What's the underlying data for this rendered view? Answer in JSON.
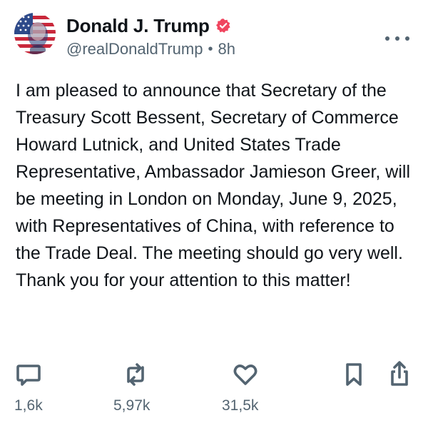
{
  "author": {
    "display_name": "Donald J. Trump",
    "handle": "@realDonaldTrump",
    "separator": "•",
    "time": "8h",
    "verified_badge_color": "#f0455f"
  },
  "icons": {
    "avatar": "flag-portrait-avatar",
    "verified": "verified-badge-icon",
    "more": "more-options-icon"
  },
  "post": {
    "text": "I am pleased to announce that Secretary of the Treasury Scott Bessent, Secretary of Commerce Howard Lutnick, and United States Trade Representative, Ambassador Jamieson Greer, will be meeting in London on Monday, June 9, 2025, with Representatives of China, with reference to the Trade Deal. The meeting should go very well. Thank you for your attention to this matter!"
  },
  "actions": {
    "replies": {
      "icon": "reply-icon",
      "count": "1,6k"
    },
    "retruths": {
      "icon": "retruth-icon",
      "count": "5,97k"
    },
    "likes": {
      "icon": "heart-icon",
      "count": "31,5k"
    },
    "bookmark": {
      "icon": "bookmark-icon"
    },
    "share": {
      "icon": "share-icon"
    }
  },
  "colors": {
    "text": "#0f1419",
    "muted": "#536471",
    "icon": "#536471"
  }
}
